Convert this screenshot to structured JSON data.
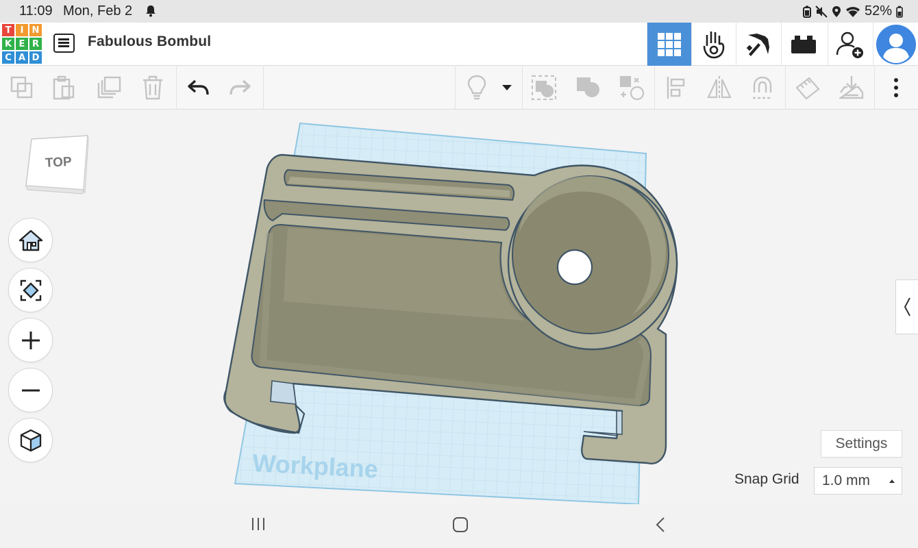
{
  "status_bar": {
    "time": "11:09",
    "date": "Mon, Feb 2",
    "battery": "52%"
  },
  "header": {
    "logo_letters": [
      "T",
      "I",
      "N",
      "K",
      "E",
      "R",
      "C",
      "A",
      "D"
    ],
    "logo_colors": [
      "#e8463c",
      "#f29a2e",
      "#f29a2e",
      "#2fb24a",
      "#2fb24a",
      "#2fb24a",
      "#2f8fd6",
      "#2f8fd6",
      "#2f8fd6"
    ],
    "project_title": "Fabulous Bombul",
    "accent_color": "#4a90d9",
    "buttons": [
      "3d-design-grid-icon",
      "codeblocks-icon",
      "pickaxe-icon",
      "bricks-icon",
      "add-user-icon",
      "profile-avatar"
    ]
  },
  "toolbar": {
    "left_buttons": [
      "copy-icon",
      "paste-icon",
      "duplicate-icon",
      "delete-icon",
      "undo-icon",
      "redo-icon"
    ],
    "right_buttons": [
      "light-bulb-icon",
      "dropdown-caret-icon",
      "group-icon",
      "ungroup-icon",
      "cruise-icon",
      "align-icon",
      "mirror-icon",
      "magnet-icon",
      "ruler-icon",
      "import-icon",
      "more-vertical-icon"
    ]
  },
  "canvas": {
    "view_cube_label": "TOP",
    "workplane_label": "Workplane",
    "settings_label": "Settings",
    "snap_grid_label": "Snap Grid",
    "snap_grid_value": "1.0 mm",
    "shape_color": "#b9b8a0",
    "workplane_color": "#cfe6f3"
  }
}
